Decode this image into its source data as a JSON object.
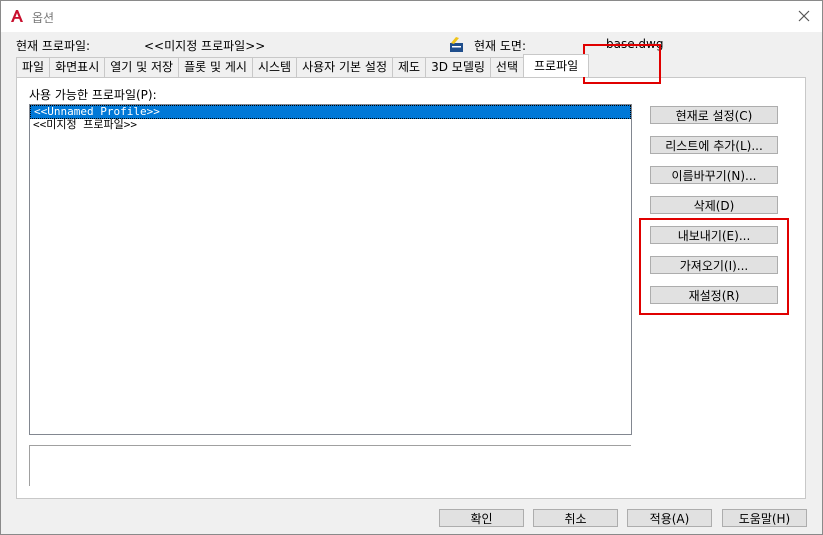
{
  "window": {
    "title": "옵션"
  },
  "header": {
    "profile_label": "현재 프로파일:",
    "profile_value": "<<미지정 프로파일>>",
    "drawing_label": "현재 도면:",
    "drawing_value": "base.dwg"
  },
  "tabs": [
    {
      "label": "파일"
    },
    {
      "label": "화면표시"
    },
    {
      "label": "열기 및 저장"
    },
    {
      "label": "플롯 및 게시"
    },
    {
      "label": "시스템"
    },
    {
      "label": "사용자 기본 설정"
    },
    {
      "label": "제도"
    },
    {
      "label": "3D 모델링"
    },
    {
      "label": "선택"
    },
    {
      "label": "프로파일"
    }
  ],
  "profiles": {
    "label": "사용 가능한 프로파일(P):",
    "items": [
      "<<Unnamed Profile>>",
      "<<미지정 프로파일>>"
    ]
  },
  "side_buttons": {
    "set_current": "현재로 설정(C)",
    "add_to_list": "리스트에 추가(L)...",
    "rename": "이름바꾸기(N)...",
    "delete": "삭제(D)",
    "export": "내보내기(E)...",
    "import": "가져오기(I)...",
    "reset": "재설정(R)"
  },
  "footer": {
    "ok": "확인",
    "cancel": "취소",
    "apply": "적용(A)",
    "help": "도움말(H)"
  },
  "colors": {
    "accent": "#0078d7",
    "highlight": "#e00000"
  }
}
